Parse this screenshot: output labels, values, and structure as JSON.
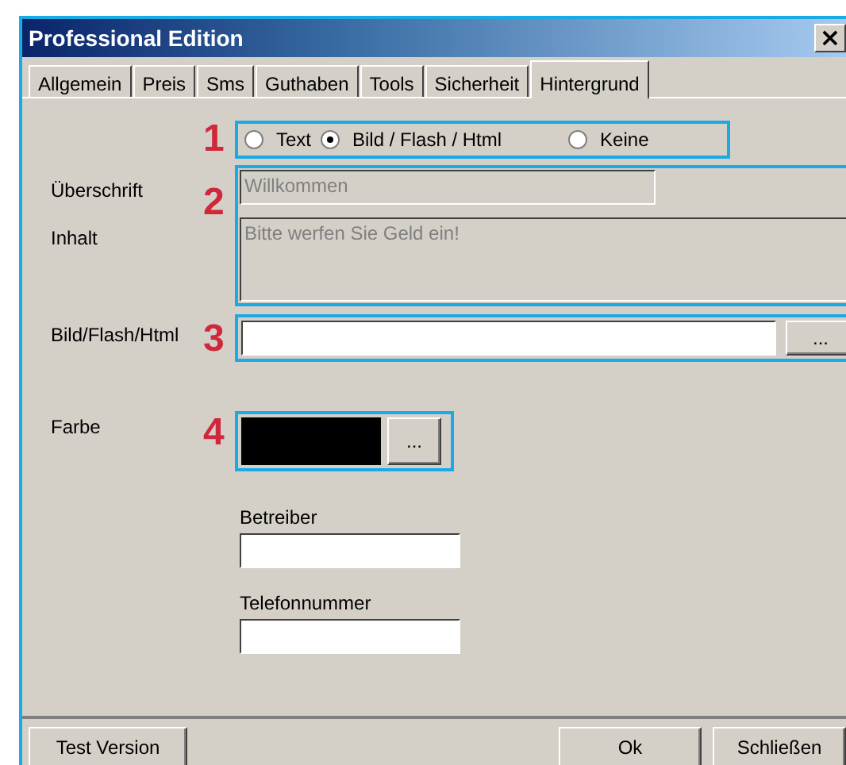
{
  "window": {
    "title": "Professional Edition",
    "close": "×"
  },
  "tabs": [
    {
      "label": "Allgemein",
      "selected": false
    },
    {
      "label": "Preis",
      "selected": false
    },
    {
      "label": "Sms",
      "selected": false
    },
    {
      "label": "Guthaben",
      "selected": false
    },
    {
      "label": "Tools",
      "selected": false
    },
    {
      "label": "Sicherheit",
      "selected": false
    },
    {
      "label": "Hintergrund",
      "selected": true
    }
  ],
  "content_type": {
    "marker": "1",
    "options": [
      {
        "label": "Text",
        "selected": false
      },
      {
        "label": "Bild / Flash / Html",
        "selected": true
      },
      {
        "label": "Keine",
        "selected": false
      }
    ]
  },
  "text_block": {
    "marker": "2",
    "heading": {
      "label": "Überschrift",
      "value": "Willkommen",
      "disabled": true
    },
    "body": {
      "label": "Inhalt",
      "value": "Bitte werfen Sie Geld ein!",
      "disabled": true
    }
  },
  "media": {
    "marker": "3",
    "label": "Bild/Flash/Html",
    "browse": "..."
  },
  "color": {
    "marker": "4",
    "label": "Farbe",
    "browse": "..."
  },
  "operator": {
    "label": "Betreiber"
  },
  "phone": {
    "label": "Telefonnummer"
  },
  "buttons": {
    "left": [
      "Test Version"
    ],
    "right": [
      "Ok",
      "Schließen"
    ]
  }
}
